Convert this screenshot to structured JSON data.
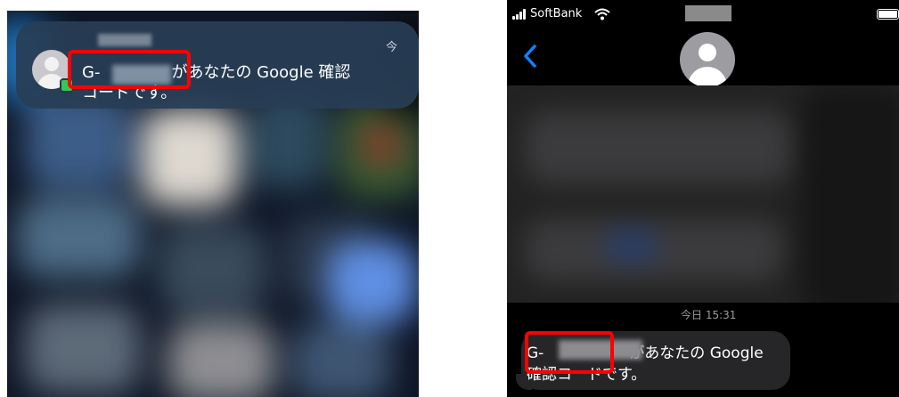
{
  "notification": {
    "time_label": "今",
    "code_prefix": "G-",
    "line1_suffix": "があなたの Google 確認",
    "line2": "コードです。",
    "badge_color": "#34c759"
  },
  "messages_app": {
    "carrier": "SoftBank",
    "date_label": "今日 15:31",
    "message": {
      "code_prefix": "G-",
      "line1_suffix": "があなたの Google",
      "line2": "確認コードです。"
    },
    "accent_color": "#0a84ff"
  },
  "highlight_color": "#ff0000",
  "icons": [
    "signal-icon",
    "wifi-icon",
    "battery-icon",
    "chevron-left-icon",
    "contact-avatar-icon",
    "messages-badge-icon"
  ]
}
